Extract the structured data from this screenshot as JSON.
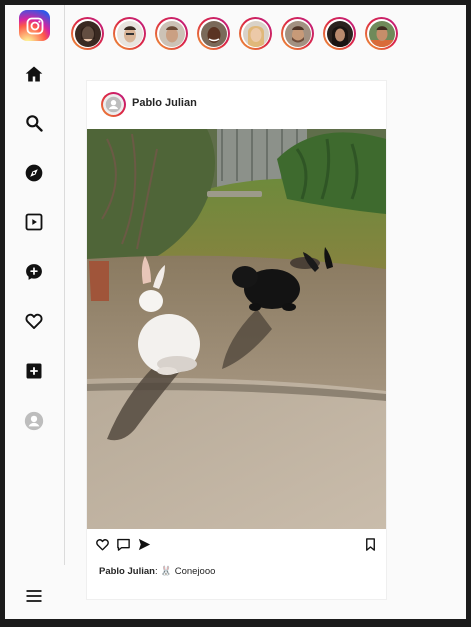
{
  "sidebar": {
    "logo_icon": "instagram-logo-icon",
    "items": [
      {
        "name": "home",
        "icon": "home-icon"
      },
      {
        "name": "search",
        "icon": "search-icon"
      },
      {
        "name": "explore",
        "icon": "compass-icon"
      },
      {
        "name": "reels",
        "icon": "reels-icon"
      },
      {
        "name": "messages",
        "icon": "messenger-icon"
      },
      {
        "name": "notifications",
        "icon": "heart-icon"
      },
      {
        "name": "create",
        "icon": "plus-square-icon"
      },
      {
        "name": "profile",
        "icon": "avatar-icon"
      }
    ],
    "menu_icon": "hamburger-menu-icon"
  },
  "stories": [
    {
      "avatar": "story-avatar-1",
      "color": "#6b4a3a"
    },
    {
      "avatar": "story-avatar-2",
      "color": "#c9a184"
    },
    {
      "avatar": "story-avatar-3",
      "color": "#b98d6d"
    },
    {
      "avatar": "story-avatar-4",
      "color": "#5a3423"
    },
    {
      "avatar": "story-avatar-5",
      "color": "#e2c09c"
    },
    {
      "avatar": "story-avatar-6",
      "color": "#c08b6a"
    },
    {
      "avatar": "story-avatar-7",
      "color": "#4b3328"
    },
    {
      "avatar": "story-avatar-8",
      "color": "#b57e5c"
    }
  ],
  "post": {
    "username": "Pablo Julian",
    "caption_user": "Pablo Julian",
    "caption_separator": ":",
    "caption_emoji": "🐰",
    "caption_text": "Conejooo",
    "image_subject": "white and black rabbits in a sunny garden"
  },
  "colors": {
    "accent_gradient_start": "#f09433",
    "accent_gradient_end": "#bc1888",
    "text": "#262626",
    "border": "#dbdbdb"
  }
}
